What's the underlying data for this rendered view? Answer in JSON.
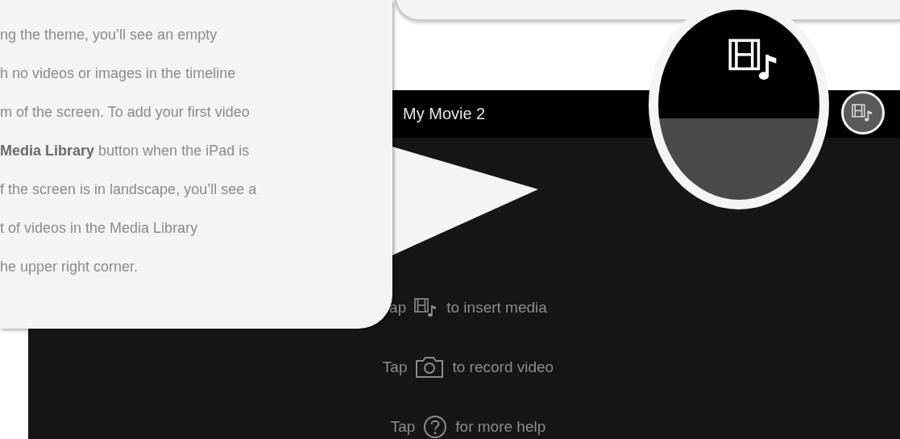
{
  "callout": {
    "lines": [
      "ng the theme, you’ll see an empty",
      "h no videos or images in the timeline",
      "m of the screen. To add your first video",
      "**Media Library** button when the iPad is",
      "f the screen is in landscape, you’ll see a",
      "t of videos in the Media Library",
      "he upper right corner."
    ]
  },
  "header": {
    "title": "My Movie 2"
  },
  "hints": [
    {
      "kind": "media",
      "prefix": "ap",
      "text": "to insert media"
    },
    {
      "kind": "camera",
      "prefix": "Tap",
      "text": "to record video"
    },
    {
      "kind": "help",
      "prefix": "Tap",
      "text": "for more help"
    }
  ]
}
